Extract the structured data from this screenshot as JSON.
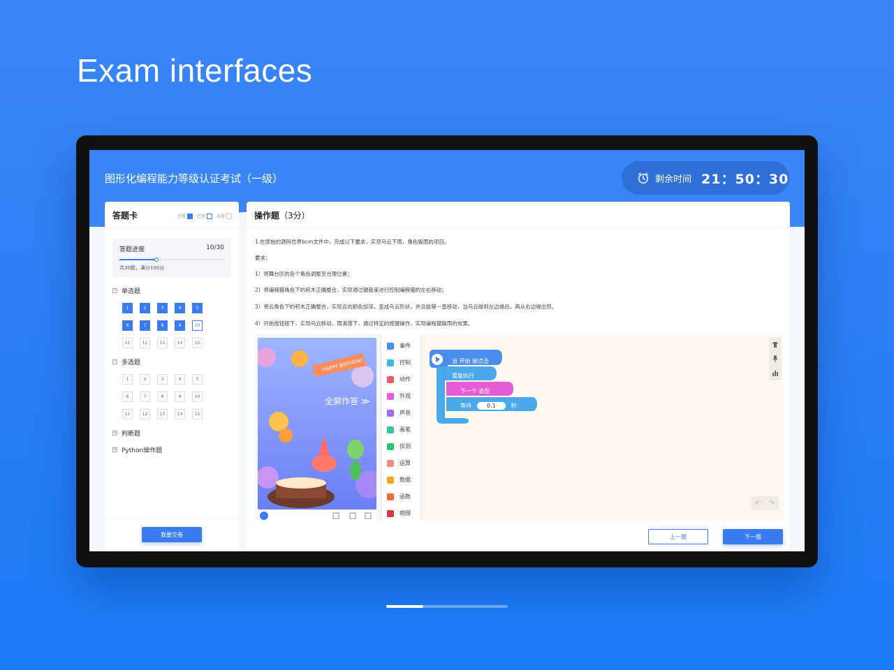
{
  "hero": {
    "title": "Exam interfaces"
  },
  "header": {
    "exam_title": "图形化编程能力等级认证考试（一级）",
    "timer_label": "剩余时间",
    "timer_value": "21：50：30"
  },
  "answer_card": {
    "title": "答题卡",
    "legend": {
      "answered": "已答",
      "marked": "已答",
      "unanswered": "未答"
    },
    "progress": {
      "label": "答题进度",
      "value": "10/30",
      "note": "共30题，满分100分",
      "fraction": 0.35
    },
    "sections": [
      {
        "label": "单选题",
        "toggle": "−",
        "items": [
          "1",
          "2",
          "3",
          "4",
          "5",
          "6",
          "7",
          "8",
          "9",
          "10",
          "11",
          "12",
          "13",
          "14",
          "15"
        ],
        "done_count": 9,
        "marked": [
          10
        ]
      },
      {
        "label": "多选题",
        "toggle": "−",
        "items": [
          "1",
          "2",
          "3",
          "4",
          "5",
          "6",
          "7",
          "8",
          "9",
          "10",
          "11",
          "12",
          "13",
          "14",
          "15"
        ],
        "done_count": 0,
        "marked": []
      },
      {
        "label": "判断题",
        "toggle": "+"
      },
      {
        "label": "Python操作题",
        "toggle": "+"
      }
    ],
    "submit_label": "我要交卷"
  },
  "question": {
    "title": "操作题",
    "score": "（3分）",
    "lines": [
      "1.在原始的源码世界bcm文件中，完成以下要求，实现乌云下雨，角色躲雨的项目。",
      "要求：",
      "1）将舞台区的各个角色调整至合理位置；",
      "2）将编程猫角色下的积木正确整合，实现通过键盘来进行控制编程猫的左右移动；",
      "3）将云角色下的积木正确整合，实现云的颜色加深，变成乌云形状，并且能够一直移动，当乌云碰到左边缘后，再从右边缘出现。",
      "4）开始按钮按下，实现乌云移动，雨滴落下，通过特定的按键操作，实现编程猫躲雨的效果。"
    ],
    "stage_fullscreen": "全屏作答 ≫",
    "stage_banner": "HAPPY BIRTHDAY",
    "categories": [
      {
        "label": "事件",
        "color": "#4a8ff0"
      },
      {
        "label": "控制",
        "color": "#40b7e8"
      },
      {
        "label": "动作",
        "color": "#ee5b67"
      },
      {
        "label": "外观",
        "color": "#e65bd6"
      },
      {
        "label": "声音",
        "color": "#a06cf0"
      },
      {
        "label": "画笔",
        "color": "#3dc3a0"
      },
      {
        "label": "侦测",
        "color": "#2fc46d"
      },
      {
        "label": "运算",
        "color": "#f08a85"
      },
      {
        "label": "数据",
        "color": "#f5a623"
      },
      {
        "label": "函数",
        "color": "#f46a3a"
      },
      {
        "label": "物理",
        "color": "#d23a4a"
      }
    ],
    "blocks": {
      "when_clicked": "当 开始 被点击",
      "repeat": "重复执行",
      "next_costume": "下一个 造型",
      "wait": "等待",
      "wait_value": "0.1",
      "wait_unit": "秒"
    },
    "prev_label": "上一题",
    "next_label": "下一题"
  },
  "pager": {
    "current": 1,
    "total": 3
  }
}
